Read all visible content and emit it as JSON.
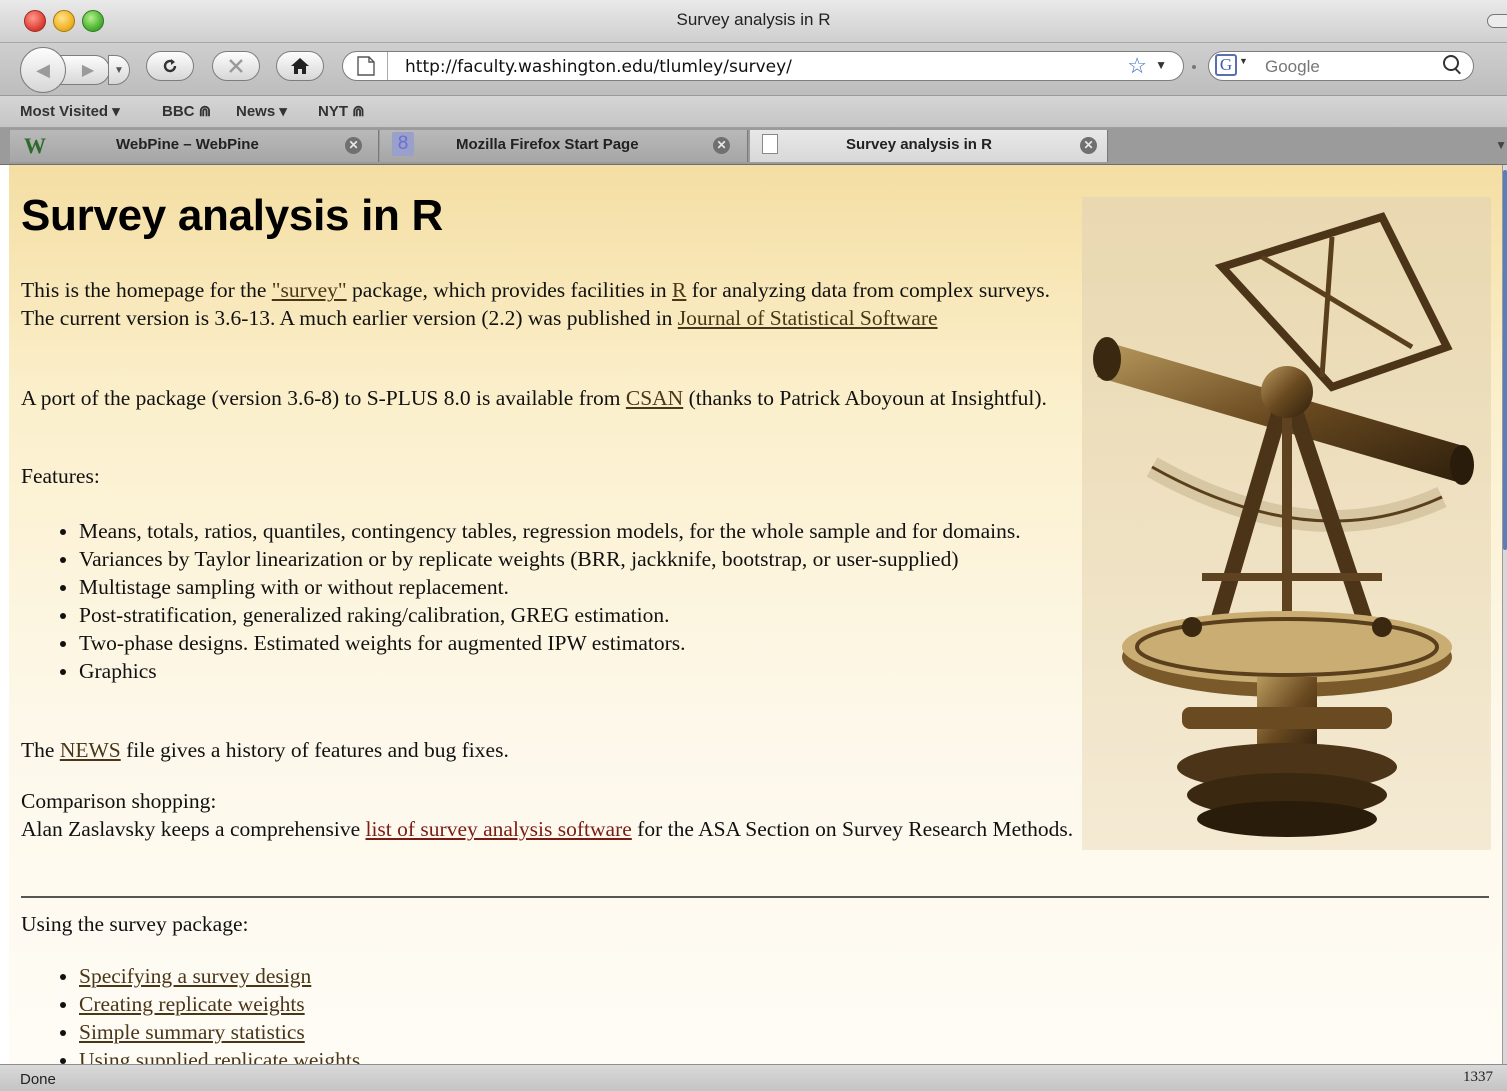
{
  "window": {
    "title": "Survey analysis in R"
  },
  "toolbar": {
    "url": "http://faculty.washington.edu/tlumley/survey/",
    "search_placeholder": "Google",
    "search_engine_letter": "G"
  },
  "bookmarks": [
    {
      "label": "Most Visited ▾"
    },
    {
      "label": "BBC ⋒"
    },
    {
      "label": "News ▾"
    },
    {
      "label": "NYT ⋒"
    }
  ],
  "tabs": [
    {
      "label": "WebPine – WebPine",
      "active": false
    },
    {
      "label": "Mozilla Firefox Start Page",
      "active": false
    },
    {
      "label": "Survey analysis in R",
      "active": true
    }
  ],
  "page": {
    "heading": "Survey analysis in R",
    "intro": {
      "t1": "This is the homepage for the ",
      "link_survey": "\"survey\"",
      "t2": " package, which provides facilities in ",
      "link_r": "R",
      "t3": " for analyzing data from complex surveys. The current version is 3.6-13. A much earlier version (2.2) was published in ",
      "link_jss": "Journal of Statistical Software"
    },
    "port": {
      "t1": "A port of the package (version 3.6-8) to S-PLUS 8.0 is available from ",
      "link_csan": "CSAN",
      "t2": " (thanks to Patrick Aboyoun at Insightful)."
    },
    "features_label": "Features:",
    "features": [
      "Means, totals, ratios, quantiles, contingency tables, regression models, for the whole sample and for domains.",
      "Variances by Taylor linearization or by replicate weights (BRR, jackknife, bootstrap, or user-supplied)",
      "Multistage sampling with or without replacement.",
      "Post-stratification, generalized raking/calibration, GREG estimation.",
      "Two-phase designs. Estimated weights for augmented IPW estimators.",
      "Graphics"
    ],
    "news": {
      "t1": "The ",
      "link_news": "NEWS",
      "t2": " file gives a history of features and bug fixes."
    },
    "comparison": {
      "label": "Comparison shopping:",
      "t1": "Alan Zaslavsky keeps a comprehensive ",
      "link": "list of survey analysis software",
      "t2": " for the ASA Section on Survey Research Methods."
    },
    "using_label": "Using the survey package:",
    "using_links": [
      "Specifying a survey design",
      "Creating replicate weights",
      "Simple summary statistics",
      "Using supplied replicate weights"
    ]
  },
  "status": {
    "text": "Done",
    "right": "1337"
  }
}
